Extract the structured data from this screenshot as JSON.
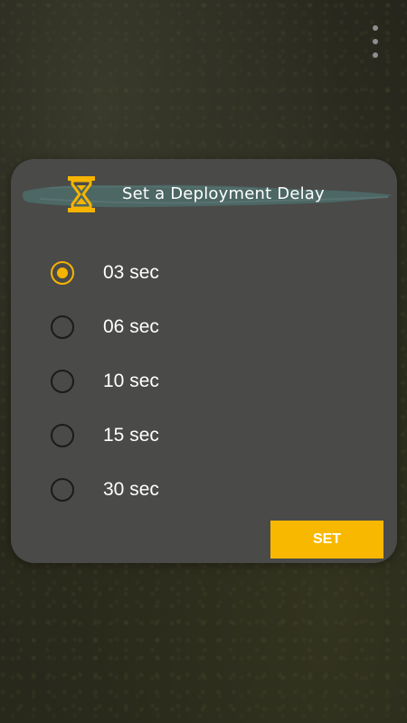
{
  "dialog": {
    "title": "Set a Deployment Delay",
    "icon": "hourglass-icon",
    "options": [
      {
        "label": "03 sec",
        "selected": true
      },
      {
        "label": "06 sec",
        "selected": false
      },
      {
        "label": "10 sec",
        "selected": false
      },
      {
        "label": "15 sec",
        "selected": false
      },
      {
        "label": "30 sec",
        "selected": false
      }
    ],
    "set_label": "SET"
  },
  "menu": {
    "icon": "overflow-menu-icon"
  },
  "colors": {
    "accent": "#f6b400",
    "dialog_bg": "#4a4a48",
    "brush": "#4c6866"
  }
}
